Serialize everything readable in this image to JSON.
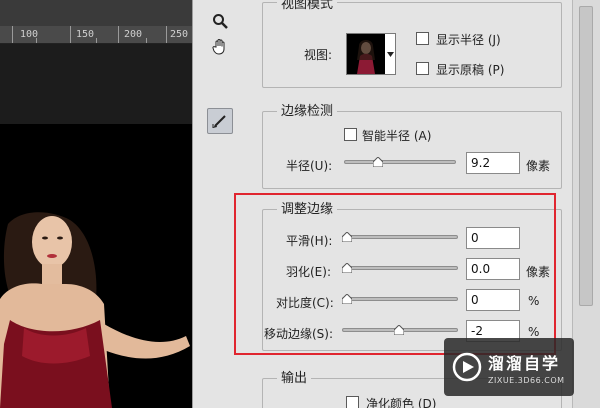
{
  "ruler": {
    "labels": [
      "100",
      "150",
      "200",
      "250"
    ]
  },
  "tools": {
    "zoom": "zoom-icon",
    "hand": "hand-icon",
    "refine": "refine-radius-brush-icon"
  },
  "view_mode": {
    "title": "视图模式",
    "view_label": "视图:",
    "show_radius": "显示半径 (J)",
    "show_original": "显示原稿 (P)"
  },
  "edge_detection": {
    "title": "边缘检测",
    "smart_radius": "智能半径 (A)",
    "radius_label": "半径(U):",
    "radius_value": "9.2",
    "radius_unit": "像素",
    "radius_level": 0.28
  },
  "adjust_edge": {
    "title": "调整边缘",
    "smooth_label": "平滑(H):",
    "smooth_value": "0",
    "smooth_level": 0.0,
    "feather_label": "羽化(E):",
    "feather_value": "0.0",
    "feather_unit": "像素",
    "feather_level": 0.0,
    "contrast_label": "对比度(C):",
    "contrast_value": "0",
    "contrast_unit": "%",
    "contrast_level": 0.0,
    "shift_label": "移动边缘(S):",
    "shift_value": "-2",
    "shift_unit": "%",
    "shift_level": 0.49
  },
  "output": {
    "title": "输出",
    "decontaminate": "净化颜色 (D)"
  },
  "watermark": {
    "name": "溜溜自学",
    "url": "ZIXUE.3D66.COM"
  },
  "colors": {
    "highlight": "#e0252f",
    "panel": "#e4e4e4",
    "canvas": "#1c1c1c"
  }
}
